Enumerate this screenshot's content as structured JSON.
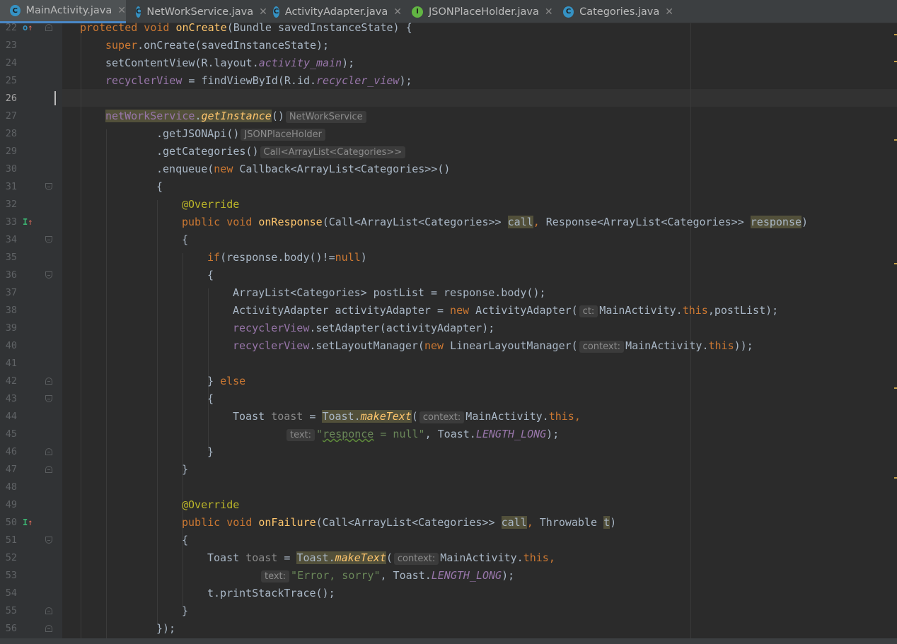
{
  "tabs": [
    {
      "label": "MainActivity.java",
      "icon": "class-icon",
      "active": true
    },
    {
      "label": "NetWorkService.java",
      "icon": "class-icon",
      "active": false
    },
    {
      "label": "ActivityAdapter.java",
      "icon": "class-icon",
      "active": false
    },
    {
      "label": "JSONPlaceHolder.java",
      "icon": "interface-icon",
      "active": false
    },
    {
      "label": "Categories.java",
      "icon": "class-icon",
      "active": false
    }
  ],
  "tab_close_glyph": "✕",
  "icon_letters": {
    "class": "C",
    "interface": "I"
  },
  "line_numbers": [
    "22",
    "23",
    "24",
    "25",
    "26",
    "27",
    "28",
    "29",
    "30",
    "31",
    "32",
    "33",
    "34",
    "35",
    "36",
    "37",
    "38",
    "39",
    "40",
    "41",
    "42",
    "43",
    "44",
    "45",
    "46",
    "47",
    "48",
    "49",
    "50",
    "51",
    "52",
    "53",
    "54",
    "55",
    "56"
  ],
  "code": {
    "l22": {
      "a": "protected void ",
      "b": "onCreate",
      "c": "(Bundle savedInstanceState) {"
    },
    "l23": {
      "a": "super",
      "b": ".onCreate(savedInstanceState);"
    },
    "l24": {
      "a": "setContentView(R.layout.",
      "b": "activity_main",
      "c": ");"
    },
    "l25": {
      "a": "recyclerView",
      "b": " = findViewById(R.id.",
      "c": "recycler_view",
      "d": ");"
    },
    "l27": {
      "a": "netWorkService",
      "b": ".",
      "c": "getInstance",
      "d": "()",
      "hint": "NetWorkService"
    },
    "l28": {
      "a": ".getJSONApi()",
      "hint": "JSONPlaceHolder"
    },
    "l29": {
      "a": ".getCategories()",
      "hint": "Call<ArrayList<Categories>>"
    },
    "l30": {
      "a": ".enqueue(",
      "b": "new ",
      "c": "Callback<ArrayList<Categories>>()"
    },
    "l31": {
      "a": "{"
    },
    "l32": {
      "a": "@Override"
    },
    "l33": {
      "a": "public void ",
      "b": "onResponse",
      "c": "(Call<ArrayList<Categories>> ",
      "d": "call",
      "e": ", ",
      "f": "Response<ArrayList<Categories>> ",
      "g": "response",
      "h": ")"
    },
    "l34": {
      "a": "{"
    },
    "l35": {
      "a": "if",
      "b": "(response.body()!=",
      "c": "null",
      "d": ")"
    },
    "l36": {
      "a": "{"
    },
    "l37": {
      "a": "ArrayList<Categories> postList = response.body();"
    },
    "l38": {
      "a": "ActivityAdapter activityAdapter = ",
      "b": "new ",
      "c": "ActivityAdapter(",
      "hint": "ct:",
      "d": "MainActivity.",
      "e": "this",
      "f": ",postList);"
    },
    "l39": {
      "a": "recyclerView",
      "b": ".setAdapter(activityAdapter);"
    },
    "l40": {
      "a": "recyclerView",
      "b": ".setLayoutManager(",
      "c": "new ",
      "d": "LinearLayoutManager(",
      "hint": "context:",
      "e": "MainActivity.",
      "f": "this",
      "g": "));"
    },
    "l42": {
      "a": "} ",
      "b": "else"
    },
    "l43": {
      "a": "{"
    },
    "l44": {
      "a": "Toast ",
      "b": "toast",
      "c": " = ",
      "d": "Toast.",
      "e": "makeText",
      "f": "(",
      "hint": "context:",
      "g": "MainActivity.",
      "h": "this",
      "i": ","
    },
    "l45": {
      "hint": "text:",
      "a": "\"",
      "b": "responce",
      "c": " = null\"",
      "d": ", Toast.",
      "e": "LENGTH_LONG",
      "f": ");"
    },
    "l46": {
      "a": "}"
    },
    "l47": {
      "a": "}"
    },
    "l49": {
      "a": "@Override"
    },
    "l50": {
      "a": "public void ",
      "b": "onFailure",
      "c": "(Call<ArrayList<Categories>> ",
      "d": "call",
      "e": ", ",
      "f": "Throwable ",
      "g": "t",
      "h": ")"
    },
    "l51": {
      "a": "{"
    },
    "l52": {
      "a": "Toast ",
      "b": "toast",
      "c": " = ",
      "d": "Toast.",
      "e": "makeText",
      "f": "(",
      "hint": "context:",
      "g": "MainActivity.",
      "h": "this",
      "i": ","
    },
    "l53": {
      "hint": "text:",
      "a": "\"Error, sorry\"",
      "b": ", Toast.",
      "c": "LENGTH_LONG",
      "d": ");"
    },
    "l54": {
      "a": "t.printStackTrace();"
    },
    "l55": {
      "a": "}"
    },
    "l56": {
      "a": "});"
    }
  },
  "colors": {
    "keyword": "#cc7832",
    "method": "#ffc66d",
    "field": "#9876aa",
    "string": "#6a8759",
    "annotation": "#bbb529",
    "text": "#a9b7c6",
    "background": "#2b2b2b",
    "tab_underline": "#4a88c7"
  }
}
